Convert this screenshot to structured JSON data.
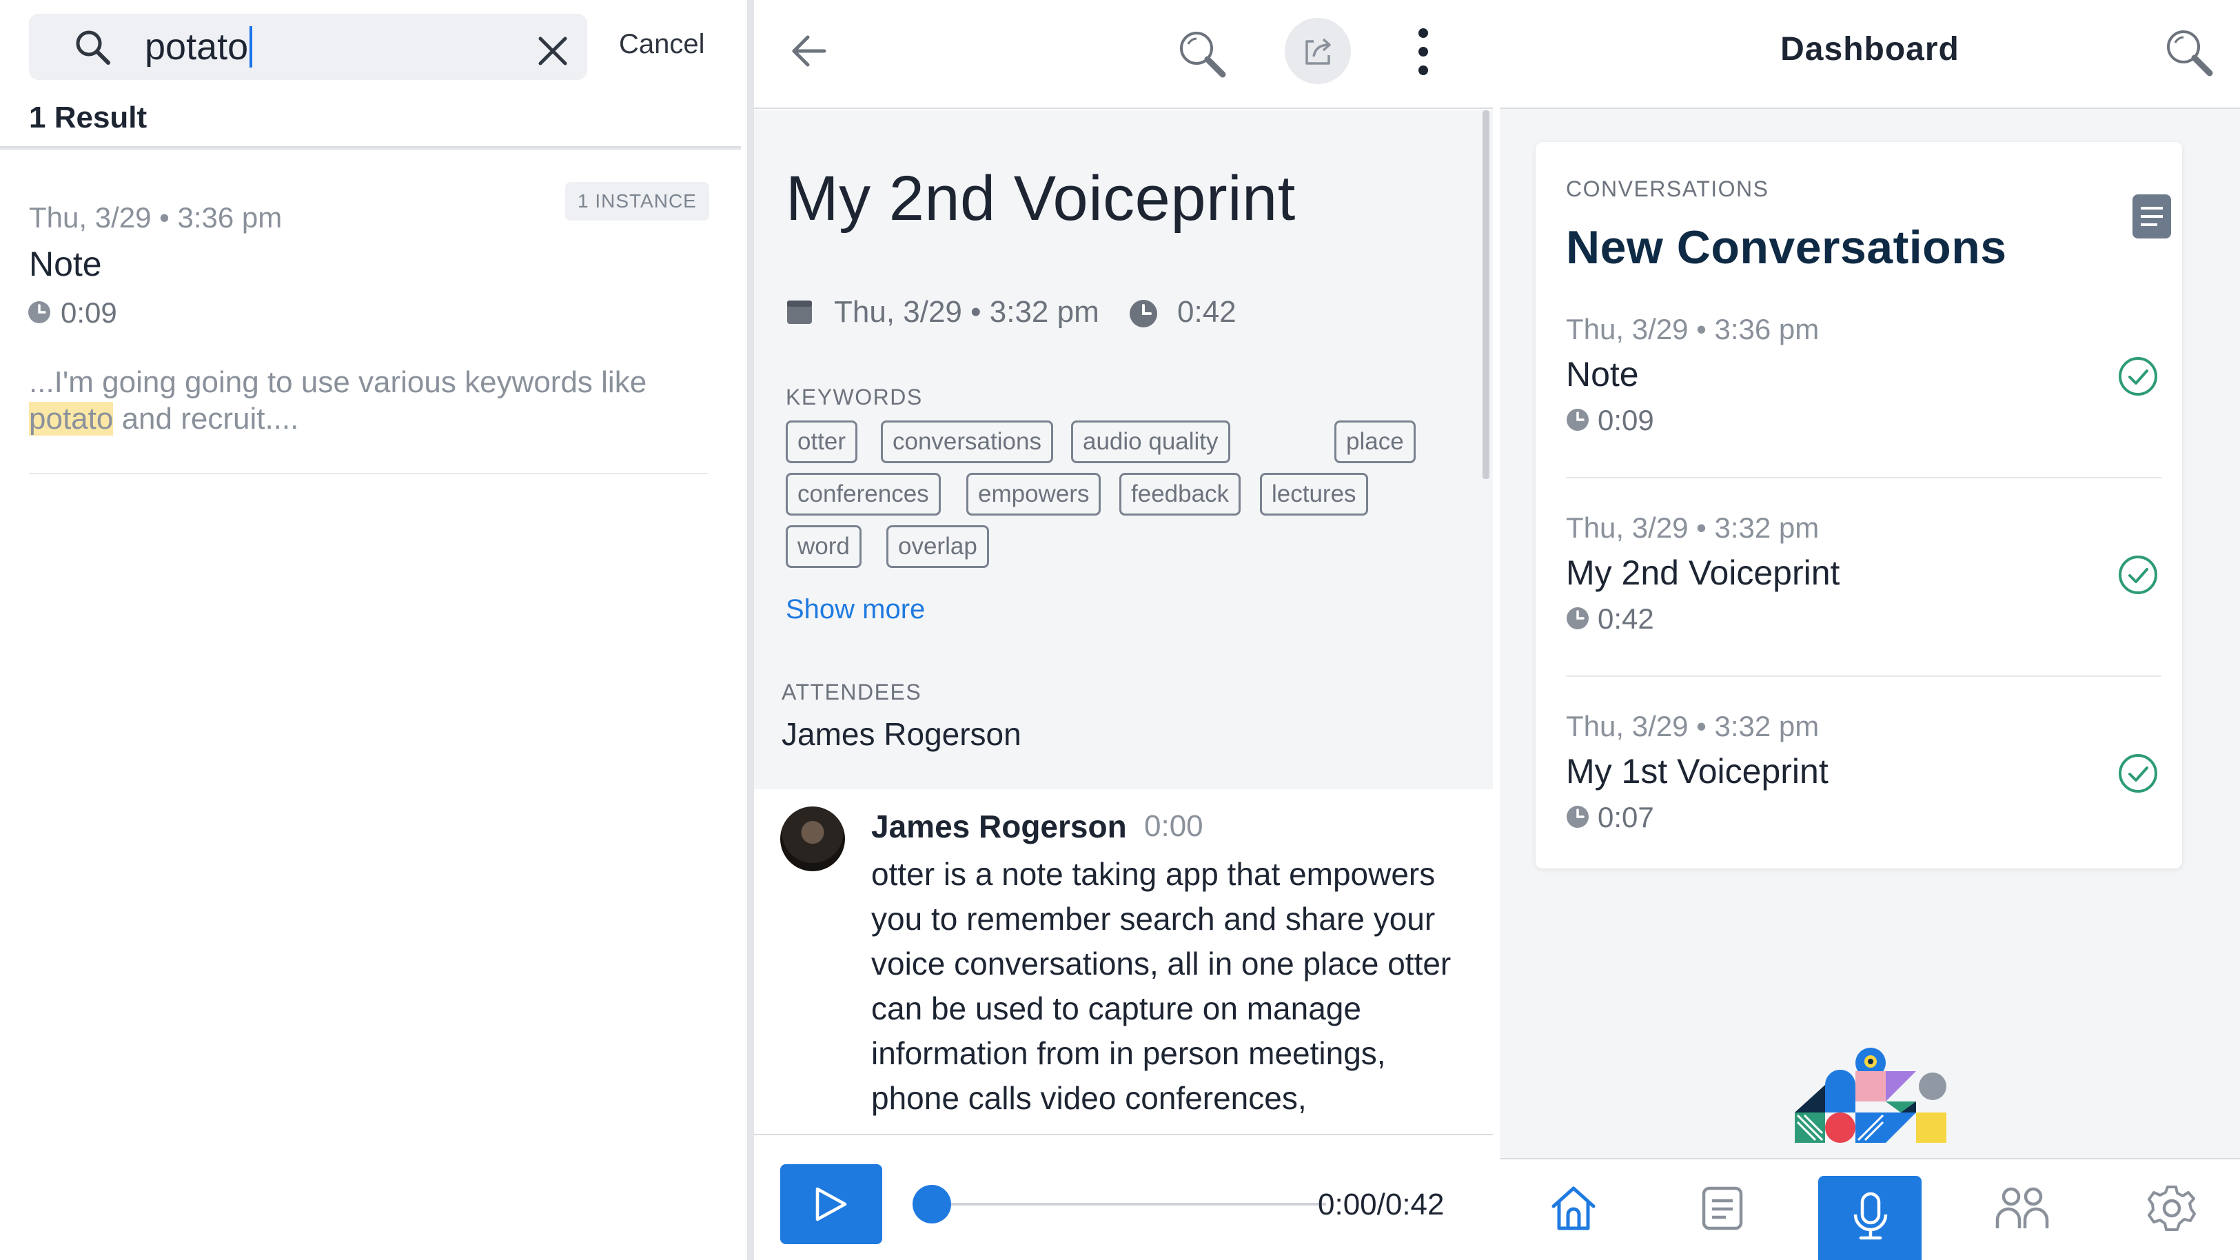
{
  "colors": {
    "accent": "#1f7ae0",
    "highlight": "#fbe7a6",
    "check_green": "#2e9b78",
    "text_dark": "#1d2533",
    "text_muted": "#8a919b"
  },
  "search_panel": {
    "query": "potato",
    "cancel_label": "Cancel",
    "result_count": "1 Result",
    "result": {
      "date": "Thu, 3/29 • 3:36 pm",
      "badge": "1 INSTANCE",
      "title": "Note",
      "duration": "0:09",
      "snippet_before": "...I'm going going to use various keywords like ",
      "snippet_match": "potato",
      "snippet_after": " and recruit...."
    },
    "icons": {
      "search": "search-icon",
      "clear": "close-icon",
      "clock": "clock-icon"
    }
  },
  "detail_panel": {
    "title": "My 2nd Voiceprint",
    "date": "Thu, 3/29 • 3:32 pm",
    "duration": "0:42",
    "keywords_label": "KEYWORDS",
    "keywords": [
      "otter",
      "conversations",
      "audio quality",
      "place",
      "conferences",
      "empowers",
      "feedback",
      "lectures",
      "word",
      "overlap"
    ],
    "show_more": "Show more",
    "attendees_label": "ATTENDEES",
    "attendee": "James Rogerson",
    "speaker": "James Rogerson",
    "speaker_time": "0:00",
    "transcript": "otter is a note taking app that empowers you to remember search and share your voice conversations, all in one place otter can be used to capture on manage information from in person meetings, phone calls video conferences, interviews, and so lectures",
    "player_time": "0:00/0:42",
    "player_progress": 0,
    "icons": {
      "back": "back-arrow-icon",
      "search": "search-icon",
      "share": "share-icon",
      "more": "more-vertical-icon",
      "play": "play-icon"
    }
  },
  "dashboard_panel": {
    "title": "Dashboard",
    "card_label": "CONVERSATIONS",
    "card_title": "New Conversations",
    "conversations": [
      {
        "date": "Thu, 3/29 • 3:36 pm",
        "title": "Note",
        "duration": "0:09"
      },
      {
        "date": "Thu, 3/29 • 3:32 pm",
        "title": "My 2nd Voiceprint",
        "duration": "0:42"
      },
      {
        "date": "Thu, 3/29 • 3:32 pm",
        "title": "My 1st Voiceprint",
        "duration": "0:07"
      }
    ],
    "nav": [
      "home-icon",
      "notes-icon",
      "microphone-icon",
      "contacts-icon",
      "settings-icon"
    ]
  }
}
